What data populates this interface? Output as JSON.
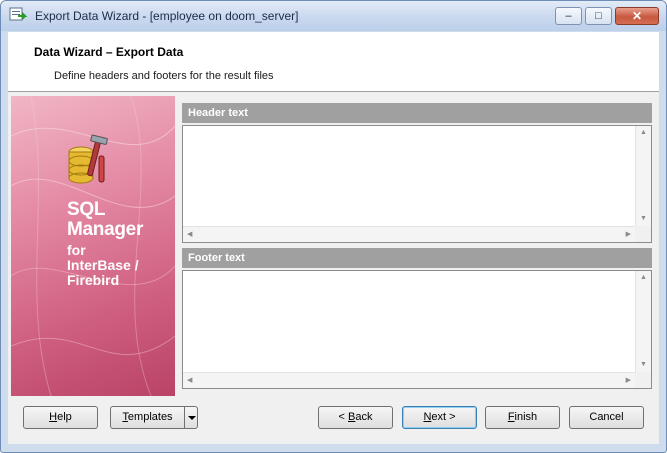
{
  "window": {
    "title": "Export Data Wizard - [employee on doom_server]",
    "controls": {
      "minimize": "–",
      "maximize": "□",
      "close": "✕"
    }
  },
  "header": {
    "title": "Data Wizard – Export Data",
    "subtitle": "Define headers and footers for the result files"
  },
  "sidebar": {
    "brand_line1": "SQL",
    "brand_line2": "Manager",
    "brand_line3": "for",
    "brand_line4": "InterBase /",
    "brand_line5": "Firebird",
    "logo_icon": "database-tools-icon"
  },
  "sections": {
    "header_text": {
      "label": "Header text",
      "value": ""
    },
    "footer_text": {
      "label": "Footer text",
      "value": ""
    }
  },
  "buttons": {
    "help": {
      "prefix": "",
      "accel": "H",
      "rest": "elp"
    },
    "templates": {
      "prefix": "",
      "accel": "T",
      "rest": "emplates"
    },
    "back": {
      "prefix": "< ",
      "accel": "B",
      "rest": "ack"
    },
    "next": {
      "prefix": "",
      "accel": "N",
      "rest": "ext >"
    },
    "finish": {
      "prefix": "",
      "accel": "F",
      "rest": "inish"
    },
    "cancel": {
      "prefix": "",
      "accel": "",
      "rest": "Cancel"
    }
  },
  "colors": {
    "accent": "#cf5f80",
    "section_header": "#a0a0a0"
  }
}
